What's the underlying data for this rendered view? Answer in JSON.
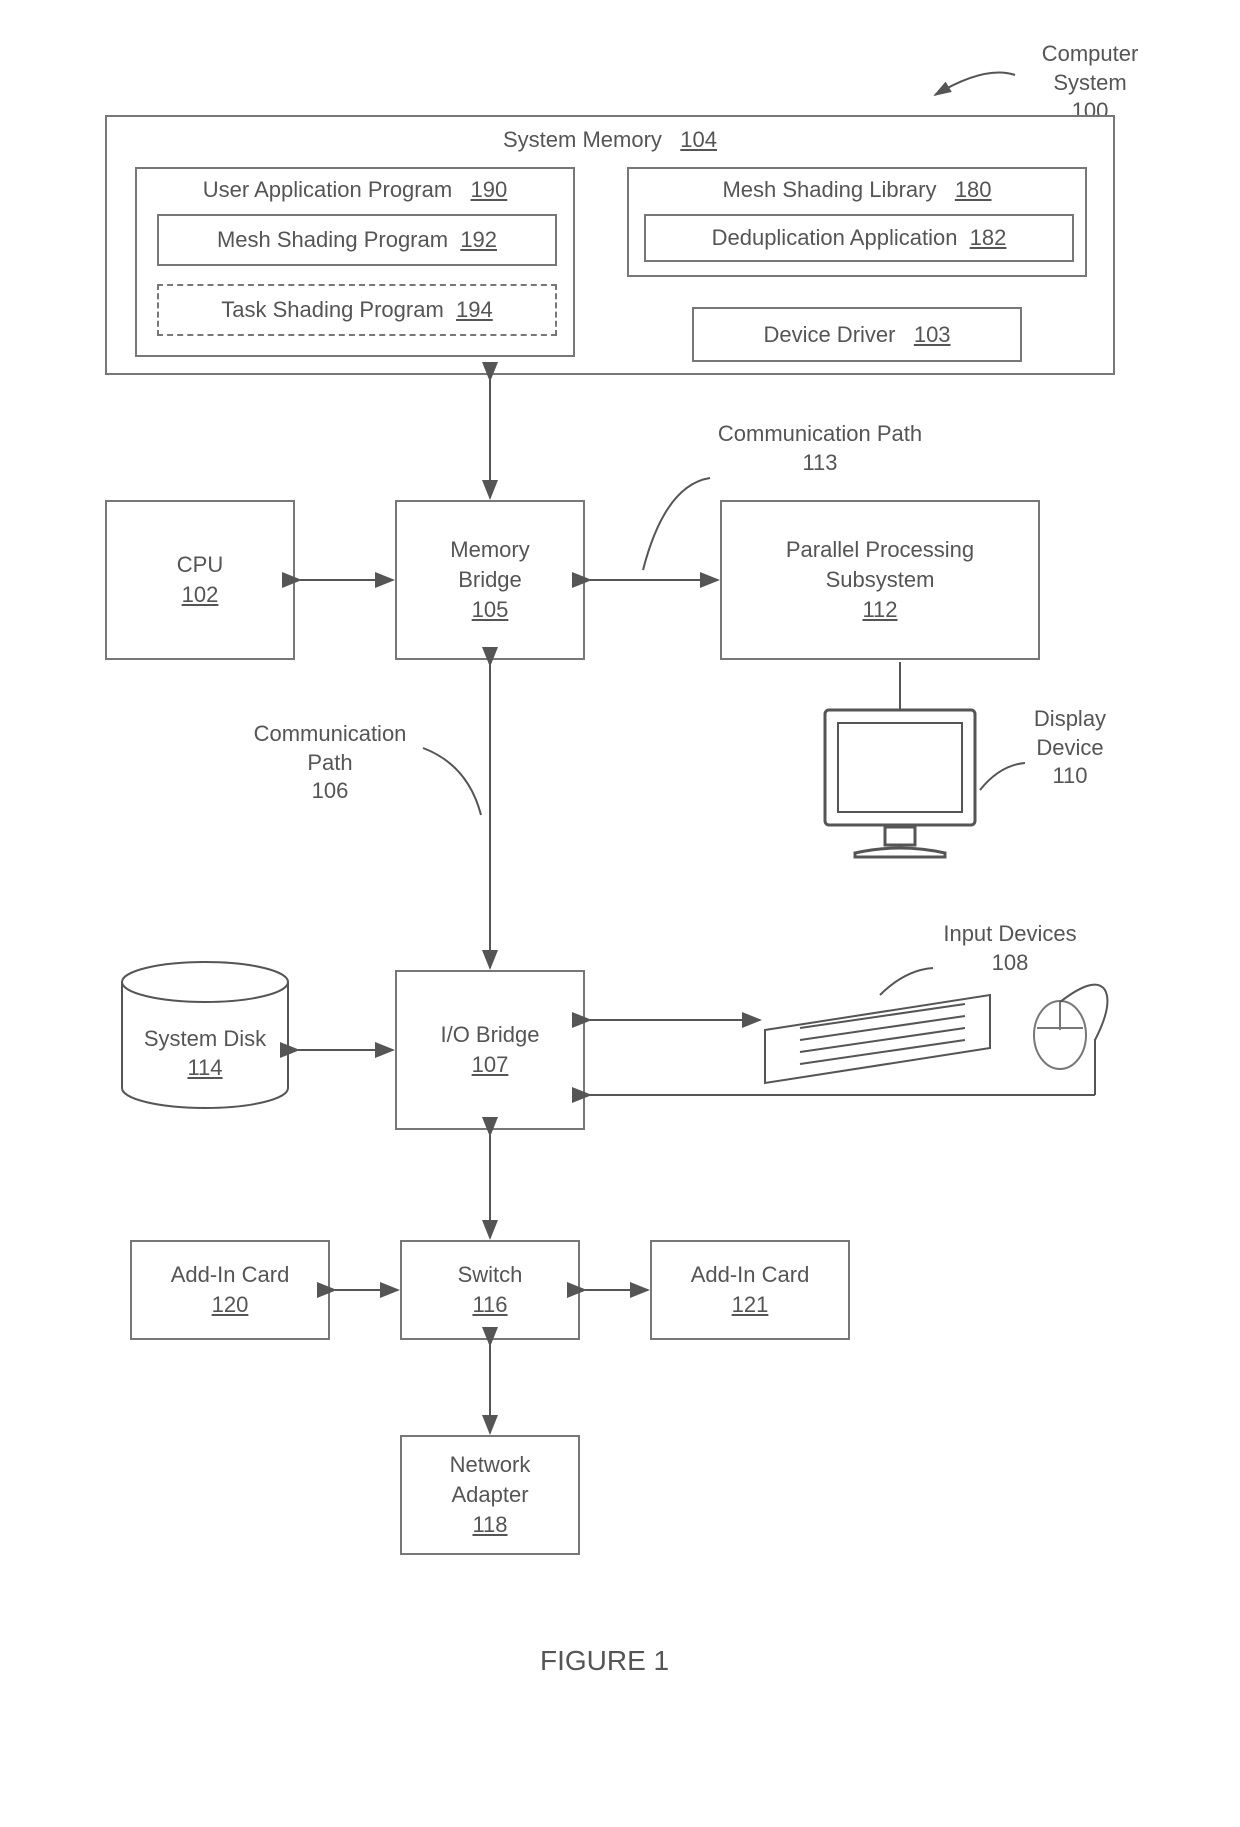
{
  "figureLabel": "FIGURE 1",
  "externalLabels": {
    "computerSystem": "Computer\nSystem\n100",
    "commPath113": "Communication Path\n113",
    "commPath106": "Communication\nPath\n106",
    "displayDevice": "Display\nDevice\n110",
    "inputDevices": "Input Devices\n108"
  },
  "boxes": {
    "systemMemory": {
      "title": "System Memory",
      "num": "104"
    },
    "userApp": {
      "title": "User Application Program",
      "num": "190"
    },
    "meshShadingProg": {
      "title": "Mesh Shading Program",
      "num": "192"
    },
    "taskShadingProg": {
      "title": "Task Shading Program",
      "num": "194"
    },
    "meshShadingLib": {
      "title": "Mesh Shading Library",
      "num": "180"
    },
    "dedupApp": {
      "title": "Deduplication Application",
      "num": "182"
    },
    "deviceDriver": {
      "title": "Device Driver",
      "num": "103"
    },
    "cpu": {
      "title": "CPU",
      "num": "102"
    },
    "memBridge": {
      "title": "Memory\nBridge",
      "num": "105"
    },
    "pps": {
      "title": "Parallel Processing\nSubsystem",
      "num": "112"
    },
    "sysDisk": {
      "title": "System Disk",
      "num": "114"
    },
    "ioBridge": {
      "title": "I/O Bridge",
      "num": "107"
    },
    "switch": {
      "title": "Switch",
      "num": "116"
    },
    "addIn120": {
      "title": "Add-In Card",
      "num": "120"
    },
    "addIn121": {
      "title": "Add-In Card",
      "num": "121"
    },
    "netAdapter": {
      "title": "Network\nAdapter",
      "num": "118"
    }
  }
}
